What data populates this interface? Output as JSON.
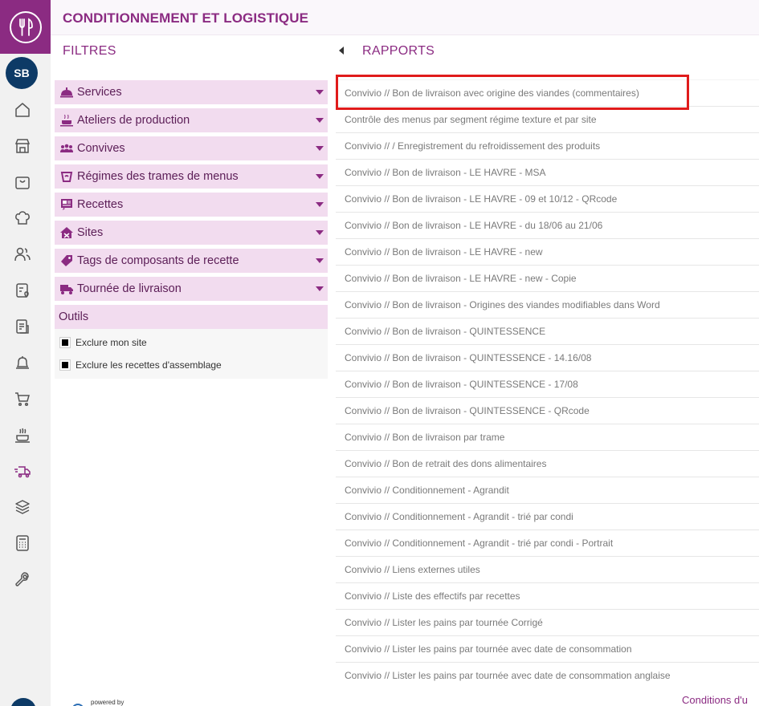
{
  "app": {
    "title": "CONDITIONNEMENT ET LOGISTIQUE",
    "user_initials": "SB",
    "accent_color": "#8b2b82"
  },
  "rail": {
    "icons": [
      "home-icon",
      "store-icon",
      "bag-icon",
      "chef-hat-icon",
      "users-icon",
      "menu-card-icon",
      "document-icon",
      "bell-icon",
      "cart-icon",
      "cooking-pot-icon",
      "delivery-truck-icon",
      "layers-icon",
      "calculator-icon",
      "wrench-icon"
    ]
  },
  "filters": {
    "title": "FILTRES",
    "items": [
      {
        "label": "Services",
        "icon": "service-cloche-icon"
      },
      {
        "label": "Ateliers de production",
        "icon": "cooking-pot-icon"
      },
      {
        "label": "Convives",
        "icon": "people-group-icon"
      },
      {
        "label": "Régimes des trames de menus",
        "icon": "diet-icon"
      },
      {
        "label": "Recettes",
        "icon": "recipe-icon"
      },
      {
        "label": "Sites",
        "icon": "site-house-icon"
      },
      {
        "label": "Tags de composants de recette",
        "icon": "tag-icon"
      },
      {
        "label": "Tournée de livraison",
        "icon": "delivery-truck-icon"
      }
    ],
    "tools": {
      "title": "Outils",
      "options": [
        {
          "label": "Exclure mon site",
          "checked": true
        },
        {
          "label": "Exclure les recettes d'assemblage",
          "checked": true
        }
      ]
    }
  },
  "reports": {
    "title": "RAPPORTS",
    "items": [
      "Convivio // Bon de livraison avec origine des viandes (commentaires)",
      "Contrôle des menus par segment régime texture et par site",
      "Convivio // / Enregistrement du refroidissement des produits",
      "Convivio // Bon de livraison - LE HAVRE - MSA",
      "Convivio // Bon de livraison - LE HAVRE - 09 et 10/12 - QRcode",
      "Convivio // Bon de livraison - LE HAVRE - du 18/06 au 21/06",
      "Convivio // Bon de livraison - LE HAVRE - new",
      "Convivio // Bon de livraison - LE HAVRE - new - Copie",
      "Convivio // Bon de livraison - Origines des viandes modifiables dans Word",
      "Convivio // Bon de livraison - QUINTESSENCE",
      "Convivio // Bon de livraison - QUINTESSENCE - 14.16/08",
      "Convivio // Bon de livraison - QUINTESSENCE - 17/08",
      "Convivio // Bon de livraison - QUINTESSENCE - QRcode",
      "Convivio // Bon de livraison par trame",
      "Convivio // Bon de retrait des dons alimentaires",
      "Convivio // Conditionnement - Agrandit",
      "Convivio // Conditionnement - Agrandit - trié par condi",
      "Convivio // Conditionnement - Agrandit - trié par condi - Portrait",
      "Convivio // Liens externes utiles",
      "Convivio // Liste des effectifs par recettes",
      "Convivio // Lister les pains par tournée Corrigé",
      "Convivio // Lister les pains par tournée avec date de consommation",
      "Convivio // Lister les pains par tournée avec date de consommation anglaise"
    ]
  },
  "footer": {
    "conditions_link": "Conditions d'u",
    "powered_by": "powered by"
  }
}
